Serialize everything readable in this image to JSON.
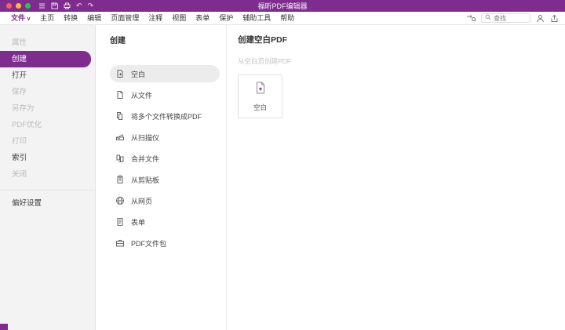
{
  "colors": {
    "accent": "#7e2d8e",
    "sidebar_bg": "#f3f3f3",
    "selected_row_bg": "#ececec"
  },
  "titlebar": {
    "title": "福昕PDF编辑器"
  },
  "menubar": {
    "file_label": "文件",
    "items": [
      "主页",
      "转换",
      "编辑",
      "页面管理",
      "注释",
      "视图",
      "表单",
      "保护",
      "辅助工具",
      "帮助"
    ],
    "active": "文件",
    "search_placeholder": "查找"
  },
  "sidebar": {
    "items": [
      {
        "label": "属性",
        "state": "disabled"
      },
      {
        "label": "创建",
        "state": "selected"
      },
      {
        "label": "打开",
        "state": "normal"
      },
      {
        "label": "保存",
        "state": "disabled"
      },
      {
        "label": "另存为",
        "state": "disabled"
      },
      {
        "label": "PDF优化",
        "state": "disabled"
      },
      {
        "label": "打印",
        "state": "disabled"
      },
      {
        "label": "索引",
        "state": "normal"
      },
      {
        "label": "关闭",
        "state": "disabled"
      }
    ],
    "preferences": "偏好设置"
  },
  "create_panel": {
    "title": "创建",
    "items": [
      {
        "label": "空白",
        "selected": true
      },
      {
        "label": "从文件",
        "selected": false
      },
      {
        "label": "将多个文件转换成PDF",
        "selected": false
      },
      {
        "label": "从扫描仪",
        "selected": false
      },
      {
        "label": "合并文件",
        "selected": false
      },
      {
        "label": "从剪贴板",
        "selected": false
      },
      {
        "label": "从网页",
        "selected": false
      },
      {
        "label": "表单",
        "selected": false
      },
      {
        "label": "PDF文件包",
        "selected": false
      }
    ]
  },
  "detail_panel": {
    "title": "创建空白PDF",
    "subtitle": "从空白页创建PDF",
    "card_label": "空白"
  }
}
